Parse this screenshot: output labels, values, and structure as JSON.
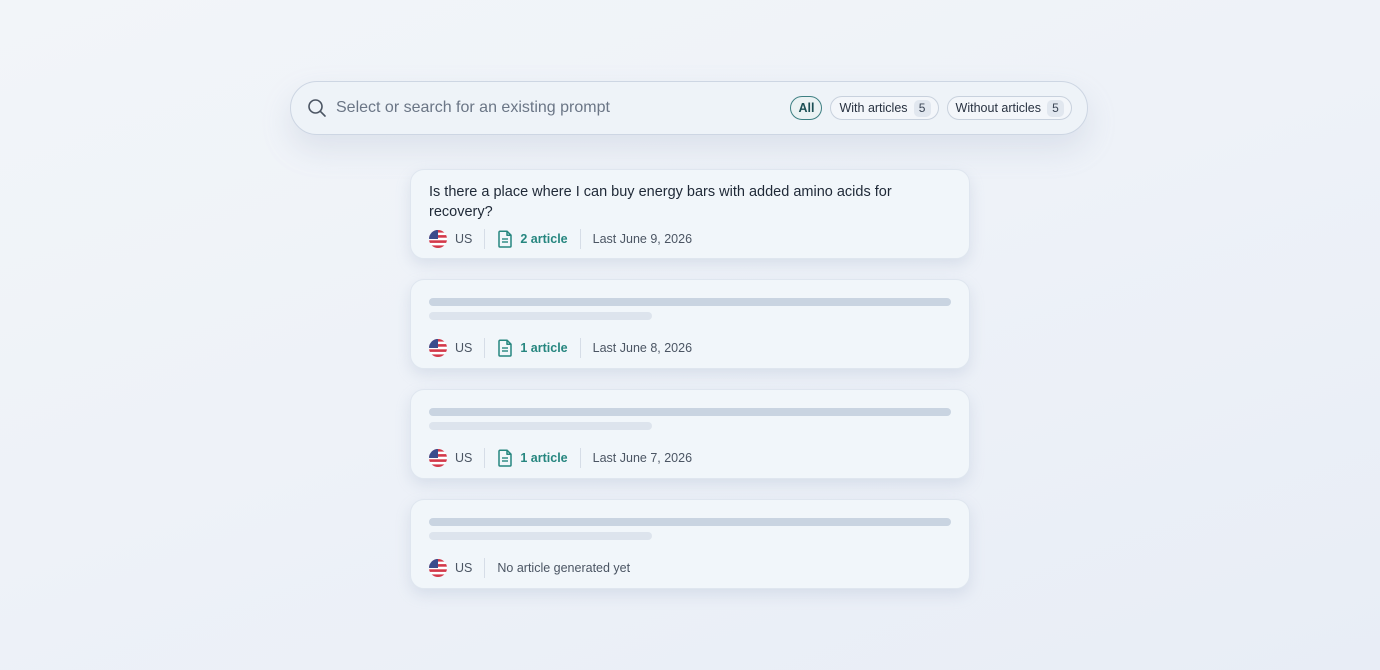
{
  "search": {
    "placeholder": "Select or search for an existing prompt",
    "icon": "search-icon"
  },
  "filters": [
    {
      "label": "All",
      "active": true
    },
    {
      "label": "With articles",
      "count": "5",
      "active": false
    },
    {
      "label": "Without articles",
      "count": "5",
      "active": false
    }
  ],
  "prompts": [
    {
      "title": "Is there a place where I can buy energy bars with added amino acids for recovery?",
      "country": "US",
      "articles": "2 article",
      "last": "Last June 9, 2026"
    },
    {
      "title": "",
      "country": "US",
      "articles": "1 article",
      "last": "Last June 8, 2026"
    },
    {
      "title": "",
      "country": "US",
      "articles": "1 article",
      "last": "Last June 7, 2026"
    },
    {
      "title": "",
      "country": "US",
      "no_article": "No article generated yet"
    }
  ],
  "colors": {
    "accent": "#26867f",
    "active_chip_border": "#3d7f82",
    "skeleton": "#c9d4e1"
  }
}
